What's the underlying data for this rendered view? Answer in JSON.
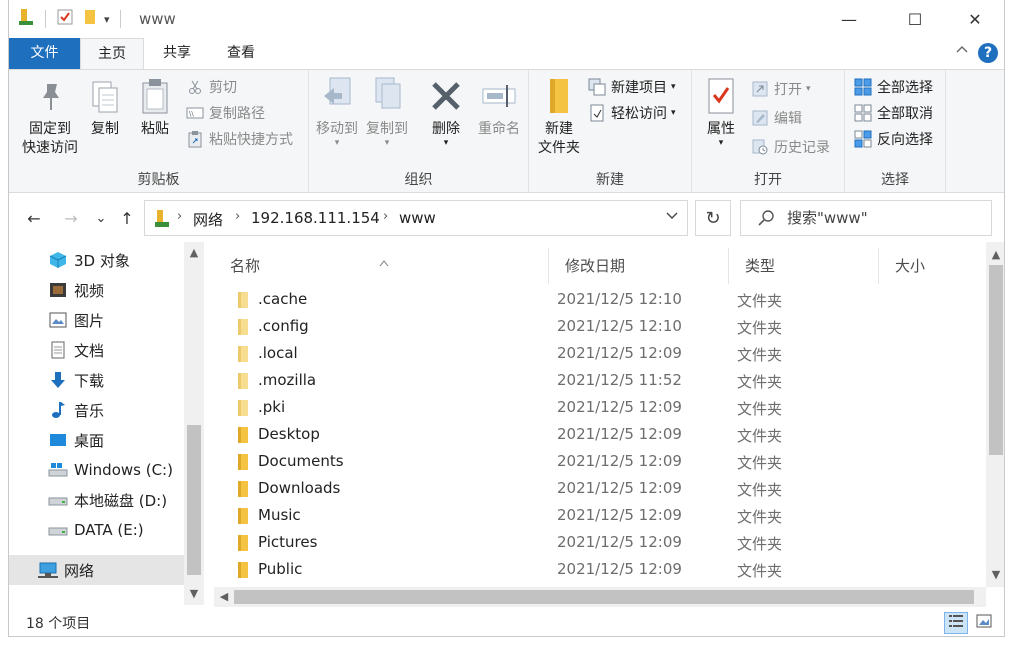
{
  "window": {
    "title": "www",
    "minimize": "—",
    "maximize": "☐",
    "close": "✕"
  },
  "quick_access": {
    "dropdown": "▾"
  },
  "tabs": [
    {
      "label": "文件"
    },
    {
      "label": "主页"
    },
    {
      "label": "共享"
    },
    {
      "label": "查看"
    }
  ],
  "help_label": "?",
  "ribbon": {
    "clipboard": {
      "label": "剪贴板",
      "pin": "固定到\n快速访问",
      "pin_line1": "固定到",
      "pin_line2": "快速访问",
      "copy": "复制",
      "paste": "粘贴",
      "cut": "剪切",
      "copy_path": "复制路径",
      "paste_shortcut": "粘贴快捷方式"
    },
    "organize": {
      "label": "组织",
      "move_to": "移动到",
      "copy_to": "复制到",
      "delete": "删除",
      "rename": "重命名"
    },
    "new": {
      "label": "新建",
      "new_folder_line1": "新建",
      "new_folder_line2": "文件夹",
      "new_item": "新建项目",
      "easy_access": "轻松访问"
    },
    "open": {
      "label": "打开",
      "properties": "属性",
      "open": "打开",
      "edit": "编辑",
      "history": "历史记录"
    },
    "select": {
      "label": "选择",
      "select_all": "全部选择",
      "select_none": "全部取消",
      "invert": "反向选择"
    }
  },
  "nav": {
    "back": "←",
    "forward": "→",
    "recent": "⌄",
    "up": "↑",
    "breadcrumb": [
      "网络",
      "192.168.111.154",
      "www"
    ],
    "separator": "›",
    "refresh": "↻",
    "search_placeholder": "搜索\"www\""
  },
  "sidebar": {
    "items": [
      {
        "label": "3D 对象",
        "icon": "cube-3d-icon"
      },
      {
        "label": "视频",
        "icon": "video-icon"
      },
      {
        "label": "图片",
        "icon": "pictures-icon"
      },
      {
        "label": "文档",
        "icon": "documents-icon"
      },
      {
        "label": "下载",
        "icon": "download-icon"
      },
      {
        "label": "音乐",
        "icon": "music-icon"
      },
      {
        "label": "桌面",
        "icon": "desktop-icon"
      },
      {
        "label": "Windows (C:)",
        "icon": "windows-drive-icon"
      },
      {
        "label": "本地磁盘 (D:)",
        "icon": "drive-icon"
      },
      {
        "label": "DATA (E:)",
        "icon": "drive-icon"
      },
      {
        "label": "网络",
        "icon": "network-icon"
      }
    ]
  },
  "columns": {
    "name": "名称",
    "date": "修改日期",
    "type": "类型",
    "size": "大小"
  },
  "files": [
    {
      "name": ".cache",
      "date": "2021/12/5 12:10",
      "type": "文件夹",
      "hidden": true
    },
    {
      "name": ".config",
      "date": "2021/12/5 12:10",
      "type": "文件夹",
      "hidden": true
    },
    {
      "name": ".local",
      "date": "2021/12/5 12:09",
      "type": "文件夹",
      "hidden": true
    },
    {
      "name": ".mozilla",
      "date": "2021/12/5 11:52",
      "type": "文件夹",
      "hidden": true
    },
    {
      "name": ".pki",
      "date": "2021/12/5 12:09",
      "type": "文件夹",
      "hidden": true
    },
    {
      "name": "Desktop",
      "date": "2021/12/5 12:09",
      "type": "文件夹",
      "hidden": false
    },
    {
      "name": "Documents",
      "date": "2021/12/5 12:09",
      "type": "文件夹",
      "hidden": false
    },
    {
      "name": "Downloads",
      "date": "2021/12/5 12:09",
      "type": "文件夹",
      "hidden": false
    },
    {
      "name": "Music",
      "date": "2021/12/5 12:09",
      "type": "文件夹",
      "hidden": false
    },
    {
      "name": "Pictures",
      "date": "2021/12/5 12:09",
      "type": "文件夹",
      "hidden": false
    },
    {
      "name": "Public",
      "date": "2021/12/5 12:09",
      "type": "文件夹",
      "hidden": false
    }
  ],
  "status": {
    "count": "18 个项目"
  },
  "colors": {
    "accent": "#1f6fbf",
    "folder": "#f5c342",
    "selected": "#e5e5e5"
  }
}
